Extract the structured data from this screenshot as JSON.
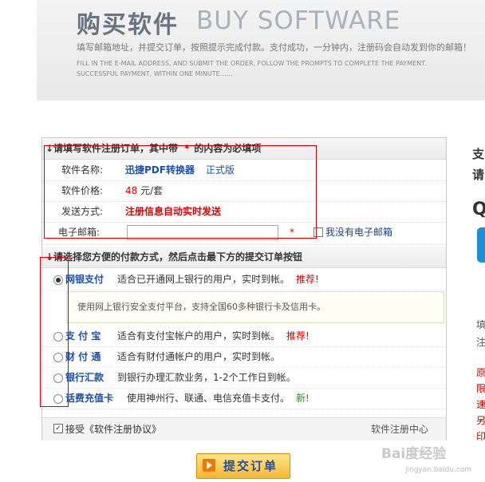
{
  "banner": {
    "title_cn": "购买软件",
    "title_en": "BUY SOFTWARE",
    "subtitle_cn": "填写邮箱地址，并提交订单，按照提示完成付款。支付成功，一分钟内，注册码会自动发到你的邮箱！",
    "subtitle_en_line1": "FILL IN THE E-MAIL ADDRESS, AND SUBMIT THE ORDER, FOLLOW THE PROMPTS TO COMPLETE THE PAYMENT.",
    "subtitle_en_line2": "SUCCESSFUL PAYMENT, WITHIN ONE MINUTE……"
  },
  "order_section": {
    "heading_prefix": "↓请填写软件注册订单，其中带",
    "heading_star": "*",
    "heading_suffix": "的内容为必填项",
    "product_label": "软件名称:",
    "product_name": "迅捷PDF转换器",
    "product_edition": "正式版",
    "price_label": "软件价格:",
    "price_value": "48",
    "price_unit": "元/套",
    "send_label": "发送方式:",
    "send_value": "注册信息自动实时发送",
    "email_label": "电子邮箱:",
    "email_value": "",
    "email_star": "*",
    "no_email_label": "我没有电子邮箱"
  },
  "payment_section": {
    "heading": "↓请选择您方便的付款方式，然后点击最下方的提交订单按钮",
    "methods": [
      {
        "name": "网银支付",
        "desc": "适合已开通网上银行的用户，实时到帐。",
        "tag": "推荐!",
        "tag_type": "rec",
        "checked": true
      },
      {
        "name": "支 付 宝",
        "desc": "适合有支付宝帐户的用户，实时到帐。",
        "tag": "推荐!",
        "tag_type": "rec",
        "checked": false
      },
      {
        "name": "财 付 通",
        "desc": "适合有财付通帐户的用户，实时到帐。",
        "tag": "",
        "tag_type": "",
        "checked": false
      },
      {
        "name": "银行汇款",
        "desc": "到银行办理汇款业务，1-2个工作日到帐。",
        "tag": "",
        "tag_type": "",
        "checked": false
      },
      {
        "name": "话费充值卡",
        "desc": "使用神州行、联通、电信充值卡支付。",
        "tag": "新!",
        "tag_type": "new",
        "checked": false
      }
    ],
    "bank_info": "使用网上银行安全支付平台，支持全国60多种银行卡及信用卡。"
  },
  "footer": {
    "agree_label": "接受《软件注册协议》",
    "center_link": "软件注册中心"
  },
  "submit_label": "提交订单",
  "side": {
    "char1": "支",
    "char2": "请",
    "char3": "Q",
    "text_fill": "填",
    "text_note": "注",
    "red_chars": [
      "原",
      "限",
      "速",
      "另",
      "印"
    ]
  },
  "watermark": {
    "logo": "Bai度经验",
    "url": "jingyan.baidu.com"
  }
}
